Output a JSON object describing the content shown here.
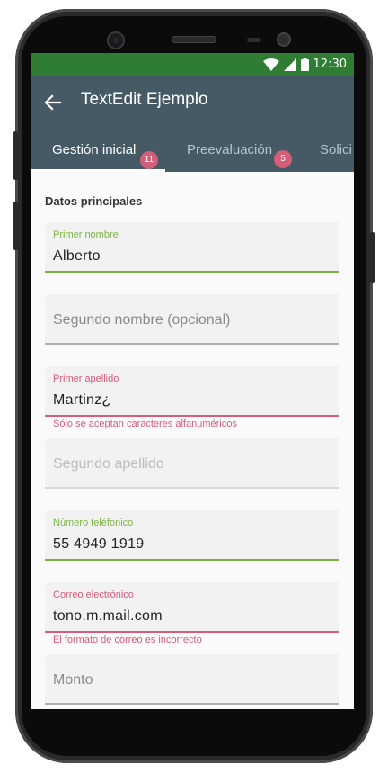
{
  "status_bar": {
    "time": "12:30",
    "icons": [
      "wifi-icon",
      "signal-icon",
      "battery-icon"
    ]
  },
  "app_bar": {
    "title": "TextEdit Ejemplo",
    "back_icon": "arrow-left-icon"
  },
  "tabs": [
    {
      "label": "Gestión inicial",
      "badge": "11",
      "active": true
    },
    {
      "label": "Preevaluación",
      "badge": "5",
      "active": false
    },
    {
      "label": "Solici",
      "active": false
    }
  ],
  "form": {
    "section_title": "Datos principales",
    "fields": [
      {
        "label": "Primer nombre",
        "value": "Alberto",
        "state": "valid"
      },
      {
        "placeholder": "Segundo nombre (opcional)",
        "state": "empty"
      },
      {
        "label": "Primer apellido",
        "value": "Martinz¿",
        "state": "error",
        "error": "Sólo se aceptan caracteres alfanuméricos"
      },
      {
        "placeholder": "Segundo apellido",
        "state": "disabled"
      },
      {
        "label": "Número teléfonico",
        "value": "55 4949 1919",
        "state": "valid"
      },
      {
        "label": "Correo electrónico",
        "value": "tono.m.mail.com",
        "state": "error",
        "error": "El formato de correo es incorrecto"
      },
      {
        "placeholder": "Monto",
        "state": "empty"
      }
    ]
  },
  "colors": {
    "status_bar": "#2e7d32",
    "app_bar": "#455a64",
    "valid": "#7cb342",
    "error": "#d45d7a",
    "badge": "#d45d7a"
  }
}
